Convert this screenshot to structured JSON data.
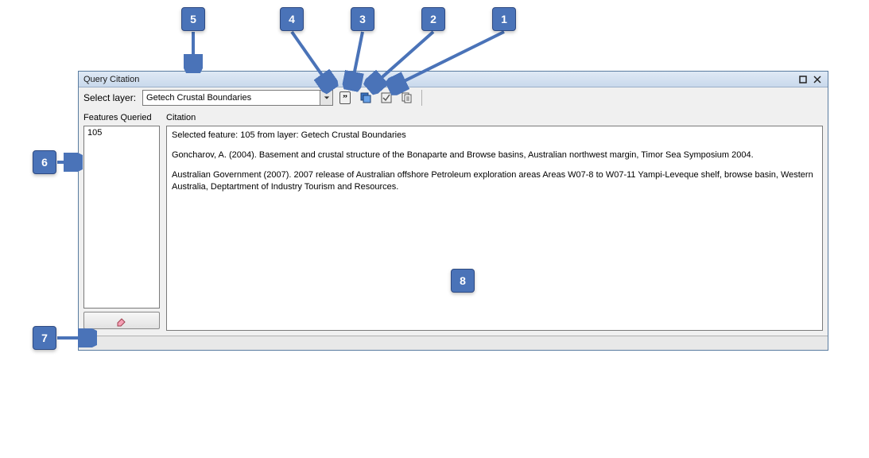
{
  "callouts": {
    "c1": "1",
    "c2": "2",
    "c3": "3",
    "c4": "4",
    "c5": "5",
    "c6": "6",
    "c7": "7",
    "c8": "8"
  },
  "dialog": {
    "title": "Query Citation",
    "select_layer_label": "Select layer:",
    "selected_layer": "Getech Crustal Boundaries",
    "features_queried_label": "Features Queried",
    "features_queried_items": [
      "105"
    ],
    "citation_label": "Citation",
    "citation_lines": [
      "Selected feature: 105 from layer: Getech Crustal Boundaries",
      "Goncharov, A. (2004). Basement and crustal structure of the Bonaparte and Browse basins, Australian northwest margin, Timor Sea Symposium 2004.",
      "Australian Government (2007). 2007 release of Australian offshore Petroleum exploration areas Areas W07-8 to W07-11 Yampi-Leveque shelf, browse basin, Western Australia, Deptartment of Industry Tourism and Resources."
    ],
    "toolbar_icons": {
      "quote": "quote-citation-icon",
      "copy": "copy-icon",
      "select": "select-feature-icon",
      "copyall": "copy-all-icon"
    }
  }
}
